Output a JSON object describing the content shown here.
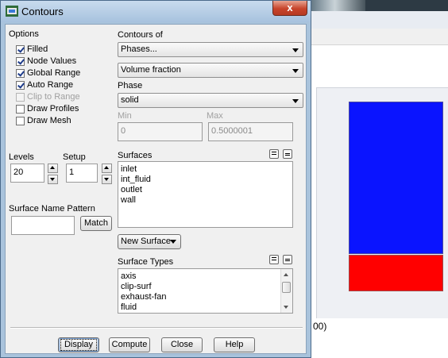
{
  "window": {
    "title": "Contours",
    "close_label": "x"
  },
  "options": {
    "heading": "Options",
    "items": [
      {
        "label": "Filled",
        "checked": true,
        "enabled": true
      },
      {
        "label": "Node Values",
        "checked": true,
        "enabled": true
      },
      {
        "label": "Global Range",
        "checked": true,
        "enabled": true
      },
      {
        "label": "Auto Range",
        "checked": true,
        "enabled": true
      },
      {
        "label": "Clip to Range",
        "checked": false,
        "enabled": false
      },
      {
        "label": "Draw Profiles",
        "checked": false,
        "enabled": true
      },
      {
        "label": "Draw Mesh",
        "checked": false,
        "enabled": true
      }
    ]
  },
  "contours_of": {
    "heading": "Contours of",
    "category": "Phases...",
    "variable": "Volume fraction"
  },
  "phase": {
    "heading": "Phase",
    "value": "solid"
  },
  "range": {
    "min_label": "Min",
    "min_value": "0",
    "max_label": "Max",
    "max_value": "0.5000001"
  },
  "levels": {
    "label": "Levels",
    "value": "20"
  },
  "setup": {
    "label": "Setup",
    "value": "1"
  },
  "surfaces": {
    "heading": "Surfaces",
    "items": [
      "inlet",
      "int_fluid",
      "outlet",
      "wall"
    ]
  },
  "surface_name_pattern": {
    "label": "Surface Name Pattern",
    "value": "",
    "match_label": "Match"
  },
  "new_surface": {
    "label": "New Surface"
  },
  "surface_types": {
    "heading": "Surface Types",
    "items": [
      "axis",
      "clip-surf",
      "exhaust-fan",
      "fluid"
    ]
  },
  "buttons": {
    "display": "Display",
    "compute": "Compute",
    "close": "Close",
    "help": "Help"
  },
  "background": {
    "partial_text": "00)"
  },
  "colors": {
    "contour_blue": "#0a14ff",
    "contour_red": "#ff0000",
    "close_button": "#c7442b"
  }
}
